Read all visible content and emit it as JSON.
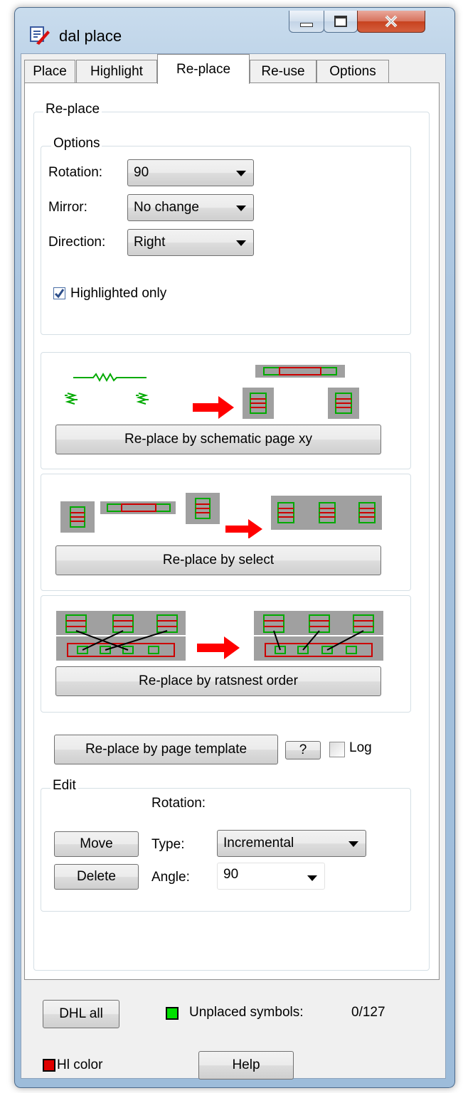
{
  "window": {
    "title": "dal place"
  },
  "tabs": [
    {
      "label": "Place"
    },
    {
      "label": "Highlight"
    },
    {
      "label": "Re-place"
    },
    {
      "label": "Re-use"
    },
    {
      "label": "Options"
    }
  ],
  "replace_group": {
    "legend": "Re-place"
  },
  "options": {
    "legend": "Options",
    "rotation": {
      "label": "Rotation:",
      "value": "90"
    },
    "mirror": {
      "label": "Mirror:",
      "value": "No change"
    },
    "direction": {
      "label": "Direction:",
      "value": "Right"
    },
    "highlighted_only": {
      "label": "Highlighted only",
      "checked": true
    }
  },
  "buttons": {
    "schematic_xy": "Re-place by schematic page xy",
    "by_select": "Re-place by select",
    "ratsnest": "Re-place by ratsnest order",
    "page_template": "Re-place by page template",
    "help_q": "?",
    "move": "Move",
    "delete": "Delete",
    "dhl_all": "DHL all",
    "help": "Help"
  },
  "log": {
    "label": "Log",
    "checked": false
  },
  "edit": {
    "legend": "Edit",
    "rotation_label": "Rotation:",
    "type": {
      "label": "Type:",
      "value": "Incremental"
    },
    "angle": {
      "label": "Angle:",
      "value": "90"
    }
  },
  "status": {
    "unplaced_label": "Unplaced symbols:",
    "unplaced_value": "0/127",
    "unplaced_color": "#00e000"
  },
  "hl_color": {
    "label": "Hl color",
    "color": "#e00000"
  }
}
